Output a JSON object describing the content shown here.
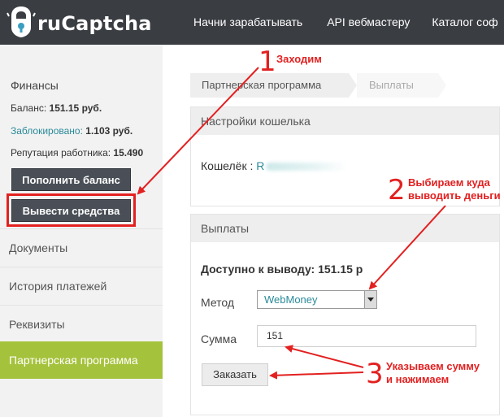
{
  "header": {
    "logo_text": "ruCaptcha",
    "nav": [
      "Начни зарабатывать",
      "API вебмастеру",
      "Каталог соф"
    ]
  },
  "sidebar": {
    "finance_title": "Финансы",
    "balance_label": "Баланс:",
    "balance_value": "151.15 руб.",
    "blocked_label": "Заблокировано:",
    "blocked_value": "1.103 руб.",
    "reputation_label": "Репутация работника:",
    "reputation_value": "15.490",
    "topup_button": "Пополнить баланс",
    "withdraw_button": "Вывести средства",
    "links": [
      "Документы",
      "История платежей",
      "Реквизиты",
      "Партнерская программа"
    ],
    "active_link_index": 3
  },
  "breadcrumb": [
    "Партнерская программа",
    "Выплаты"
  ],
  "wallet_panel": {
    "title": "Настройки кошелька",
    "wallet_label": "Кошелёк :",
    "wallet_value_visible": "R"
  },
  "payout_panel": {
    "title": "Выплаты",
    "available": "Доступно к выводу: 151.15 р",
    "method_label": "Метод",
    "method_value": "WebMoney",
    "amount_label": "Сумма",
    "amount_value": "151",
    "order_button": "Заказать"
  },
  "annotations": [
    {
      "number": "1",
      "text": "Заходим"
    },
    {
      "number": "2",
      "text": "Выбираем куда\nвыводить деньги"
    },
    {
      "number": "3",
      "text": "Указываем сумму\nи нажимаем"
    }
  ],
  "colors": {
    "header_bg": "#3a3d42",
    "sidebar_bg": "#f2f2f2",
    "active_green": "#a5c23c",
    "annotation_red": "#e32020",
    "link_teal": "#2a8a9a"
  }
}
